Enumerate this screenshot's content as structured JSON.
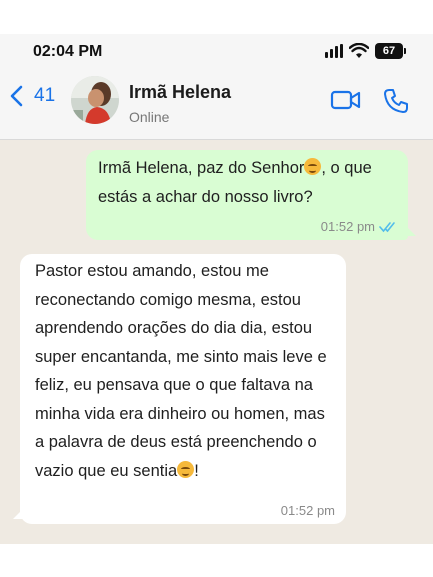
{
  "status_bar": {
    "time": "02:04 PM",
    "battery": "67"
  },
  "header": {
    "back_count": "41",
    "contact_name": "Irmã Helena",
    "contact_status": "Online"
  },
  "messages": [
    {
      "direction": "outgoing",
      "text_before_emoji": "Irmã Helena, paz do Senhor",
      "text_after_emoji": ", o que estás a achar do nosso livro?",
      "time": "01:52 pm",
      "read_status": "read"
    },
    {
      "direction": "incoming",
      "text_before_emoji": "Pastor estou amando, estou me reconectando comigo mesma, estou aprendendo orações do dia dia, estou super encantanda, me sinto mais leve e feliz, eu pensava que o que faltava na minha vida era dinheiro ou homen, mas a palavra de deus está preenchendo o vazio que eu sentia",
      "text_after_emoji": "!",
      "time": "01:52 pm"
    }
  ],
  "colors": {
    "accent": "#1a73e8",
    "outgoing_bubble": "#d9fdd3",
    "chat_background": "#efeae2",
    "read_ticks": "#53bdeb"
  },
  "icons": [
    "back-chevron-icon",
    "video-call-icon",
    "phone-call-icon",
    "emoji-pensive-icon",
    "double-check-icon",
    "signal-icon",
    "wifi-icon",
    "battery-icon"
  ]
}
